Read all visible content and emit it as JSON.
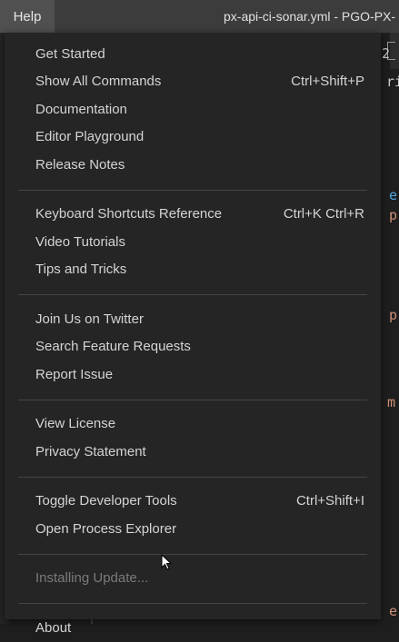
{
  "titlebar": {
    "menu_label": "Help",
    "window_title": "px-api-ci-sonar.yml - PGO-PX-"
  },
  "background_text": {
    "g1": "2",
    "g2": "ri",
    "g3": "e",
    "g4": "p",
    "g5": "p",
    "g6": "m",
    "g7": "e"
  },
  "menu": {
    "groups": [
      [
        {
          "label": "Get Started",
          "shortcut": ""
        },
        {
          "label": "Show All Commands",
          "shortcut": "Ctrl+Shift+P"
        },
        {
          "label": "Documentation",
          "shortcut": ""
        },
        {
          "label": "Editor Playground",
          "shortcut": ""
        },
        {
          "label": "Release Notes",
          "shortcut": ""
        }
      ],
      [
        {
          "label": "Keyboard Shortcuts Reference",
          "shortcut": "Ctrl+K Ctrl+R"
        },
        {
          "label": "Video Tutorials",
          "shortcut": ""
        },
        {
          "label": "Tips and Tricks",
          "shortcut": ""
        }
      ],
      [
        {
          "label": "Join Us on Twitter",
          "shortcut": ""
        },
        {
          "label": "Search Feature Requests",
          "shortcut": ""
        },
        {
          "label": "Report Issue",
          "shortcut": ""
        }
      ],
      [
        {
          "label": "View License",
          "shortcut": ""
        },
        {
          "label": "Privacy Statement",
          "shortcut": ""
        }
      ],
      [
        {
          "label": "Toggle Developer Tools",
          "shortcut": "Ctrl+Shift+I"
        },
        {
          "label": "Open Process Explorer",
          "shortcut": ""
        }
      ],
      [
        {
          "label": "Installing Update...",
          "shortcut": "",
          "disabled": true
        }
      ],
      [
        {
          "label": "About",
          "shortcut": ""
        }
      ]
    ]
  }
}
